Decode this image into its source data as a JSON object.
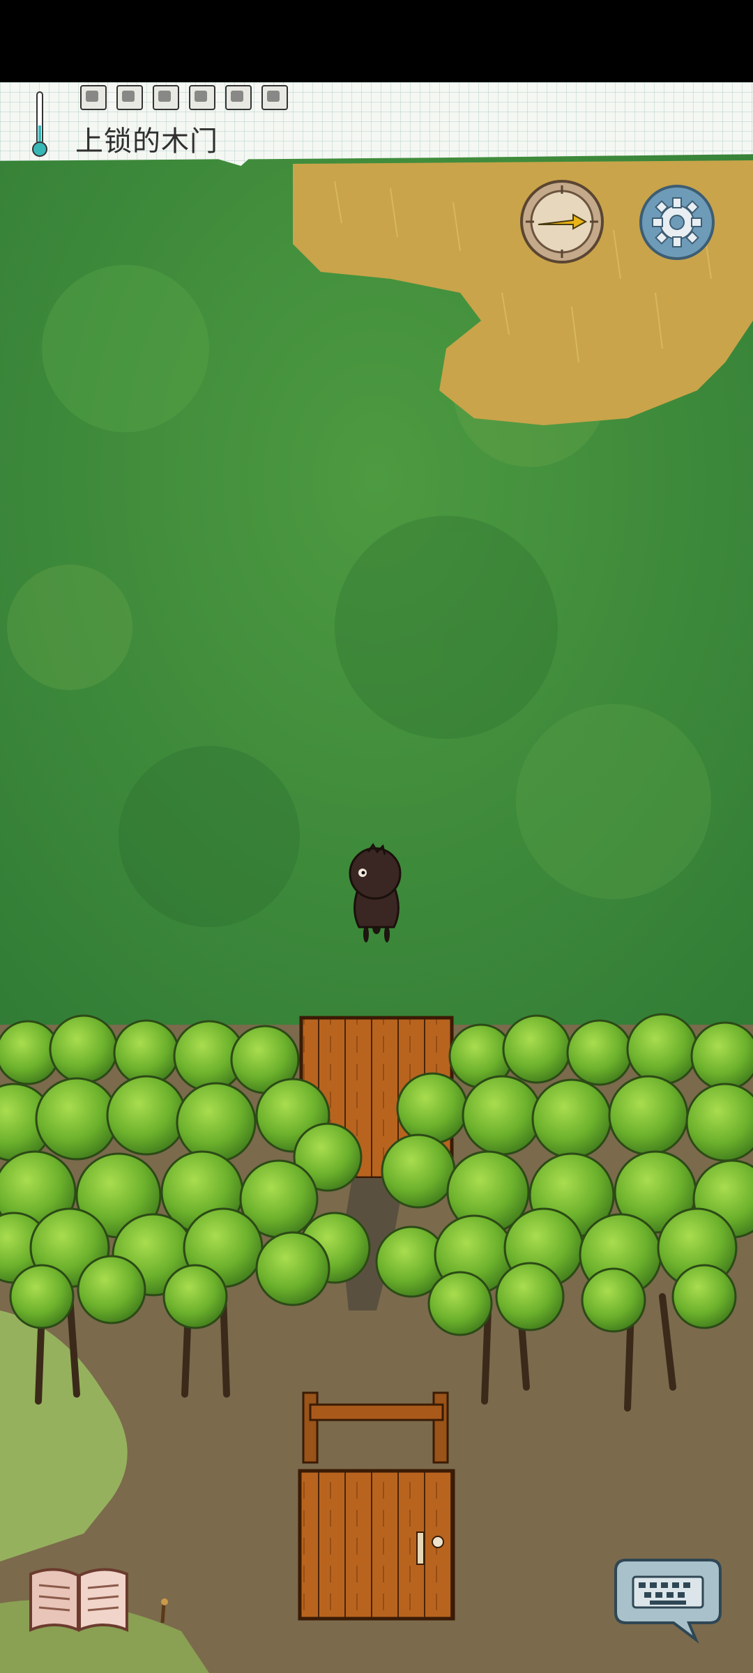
{
  "hud": {
    "location_label": "上锁的木门",
    "inventory_slots": 6,
    "icons": [
      "thermometer-icon",
      "compass-icon",
      "gear-icon",
      "journal-icon",
      "keyboard-icon"
    ]
  },
  "colors": {
    "grass": "#3f8a3a",
    "dry_grass": "#c9a44a",
    "dirt": "#7a6a4e",
    "wood": "#b5621f",
    "foliage": "#6fb62e",
    "character": "#3a2622"
  }
}
